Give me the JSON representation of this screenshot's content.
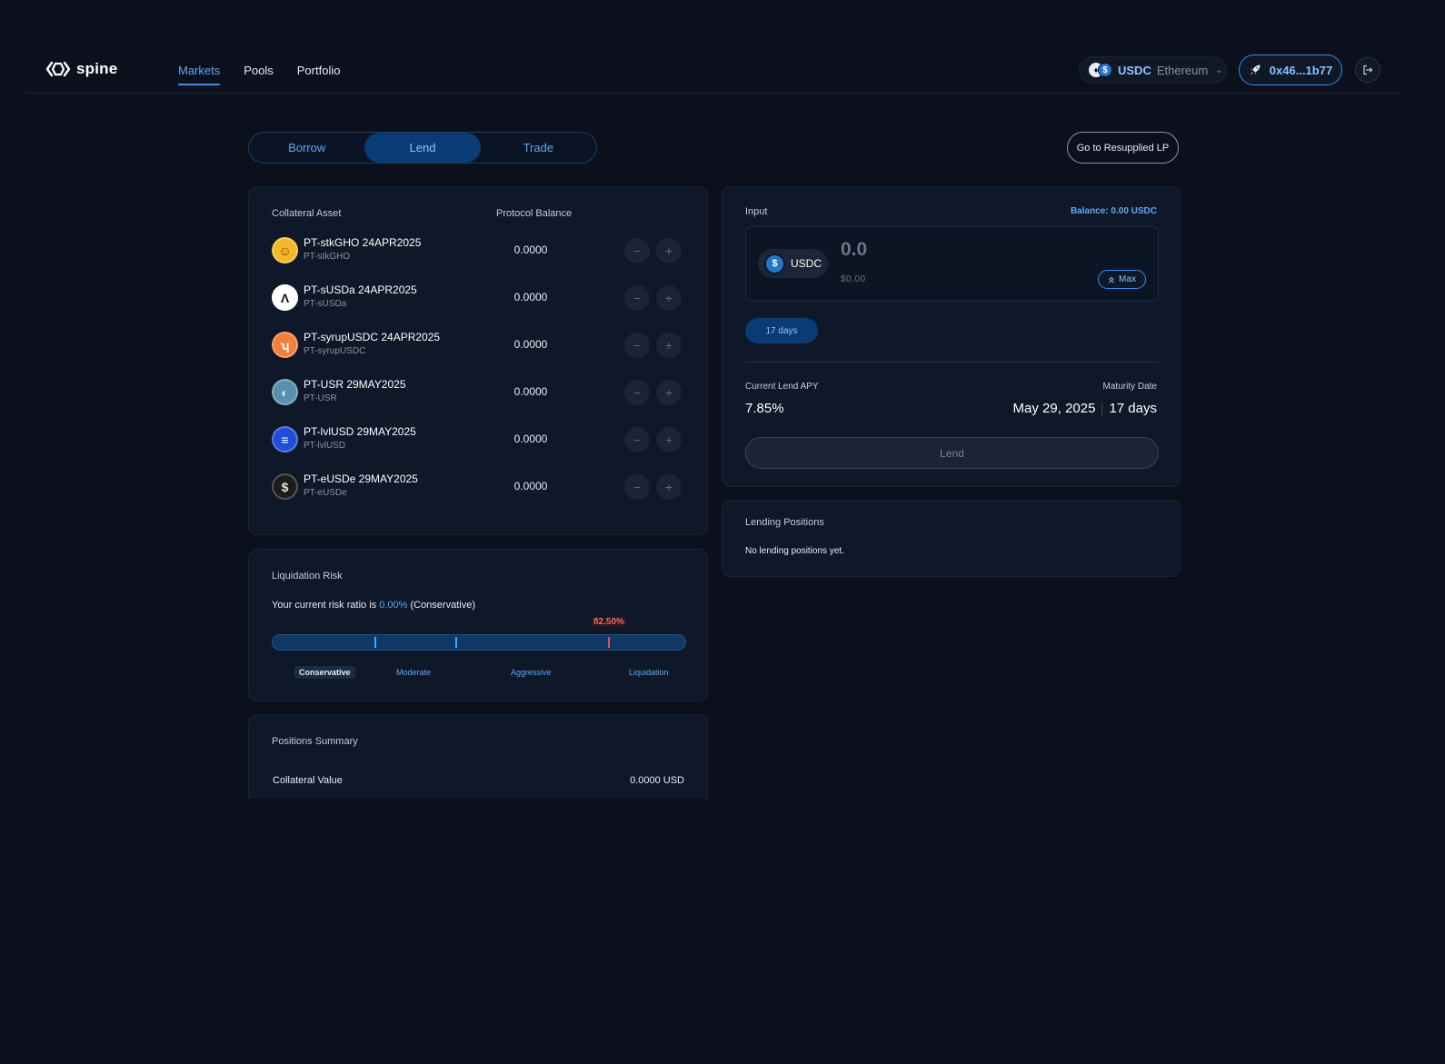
{
  "header": {
    "logo_text": "spine",
    "nav": [
      {
        "label": "Markets",
        "active": true
      },
      {
        "label": "Pools",
        "active": false
      },
      {
        "label": "Portfolio",
        "active": false
      }
    ],
    "network": {
      "token": "USDC",
      "chain": "Ethereum"
    },
    "wallet": {
      "address": "0x46...1b77"
    }
  },
  "mode_tabs": [
    {
      "label": "Borrow",
      "active": false
    },
    {
      "label": "Lend",
      "active": true
    },
    {
      "label": "Trade",
      "active": false
    }
  ],
  "resupply_button": "Go to Resupplied LP",
  "collateral": {
    "header_asset": "Collateral Asset",
    "header_balance": "Protocol Balance",
    "assets": [
      {
        "name": "PT-stkGHO 24APR2025",
        "symbol": "PT-stkGHO",
        "balance": "0.0000",
        "icon_color": "#f5b82a",
        "icon_fg": "#7a4b00",
        "icon_glyph": "☺",
        "icon_name": "stkgho-icon"
      },
      {
        "name": "PT-sUSDa 24APR2025",
        "symbol": "PT-sUSDa",
        "balance": "0.0000",
        "icon_color": "#ffffff",
        "icon_fg": "#111111",
        "icon_glyph": "Λ",
        "icon_name": "susda-icon"
      },
      {
        "name": "PT-syrupUSDC 24APR2025",
        "symbol": "PT-syrupUSDC",
        "balance": "0.0000",
        "icon_color": "#f0803c",
        "icon_fg": "#ffffff",
        "icon_glyph": "ʮ",
        "icon_name": "syrupusdc-icon"
      },
      {
        "name": "PT-USR 29MAY2025",
        "symbol": "PT-USR",
        "balance": "0.0000",
        "icon_color": "#5a8fb0",
        "icon_fg": "#dbe8f3",
        "icon_glyph": "◐",
        "icon_name": "usr-icon"
      },
      {
        "name": "PT-lvlUSD 29MAY2025",
        "symbol": "PT-lvlUSD",
        "balance": "0.0000",
        "icon_color": "#1f4fd8",
        "icon_fg": "#ffffff",
        "icon_glyph": "≡",
        "icon_name": "lvlusd-icon"
      },
      {
        "name": "PT-eUSDe 29MAY2025",
        "symbol": "PT-eUSDe",
        "balance": "0.0000",
        "icon_color": "#1c1c1c",
        "icon_fg": "#e8e2d0",
        "icon_glyph": "$",
        "icon_name": "eusde-icon"
      }
    ]
  },
  "risk": {
    "title": "Liquidation Risk",
    "ratio_prefix": "Your current risk ratio is ",
    "ratio_value": "0.00%",
    "ratio_suffix": " (Conservative)",
    "liquidation_label": "82.50%",
    "liquidation_level": 0.825,
    "scale": [
      "Conservative",
      "Moderate",
      "Aggressive",
      "Liquidation"
    ]
  },
  "summary": {
    "title": "Positions Summary",
    "collateral_label": "Collateral Value",
    "collateral_value": "0.0000 USD"
  },
  "lend": {
    "input_label": "Input",
    "balance": "Balance: 0.00 USDC",
    "token": "USDC",
    "amount_placeholder": "0.0",
    "usd_value": "$0.00",
    "max_label": "Max",
    "days_chip": "17 days",
    "apy_label": "Current Lend APY",
    "apy_value": "7.85%",
    "maturity_label": "Maturity Date",
    "maturity_date": "May 29, 2025",
    "maturity_days": "17 days",
    "button": "Lend"
  },
  "positions": {
    "title": "Lending Positions",
    "empty": "No lending positions yet."
  },
  "colors": {
    "background": "#0b101c",
    "accent": "#3b8ff0",
    "danger": "#e0554f"
  }
}
